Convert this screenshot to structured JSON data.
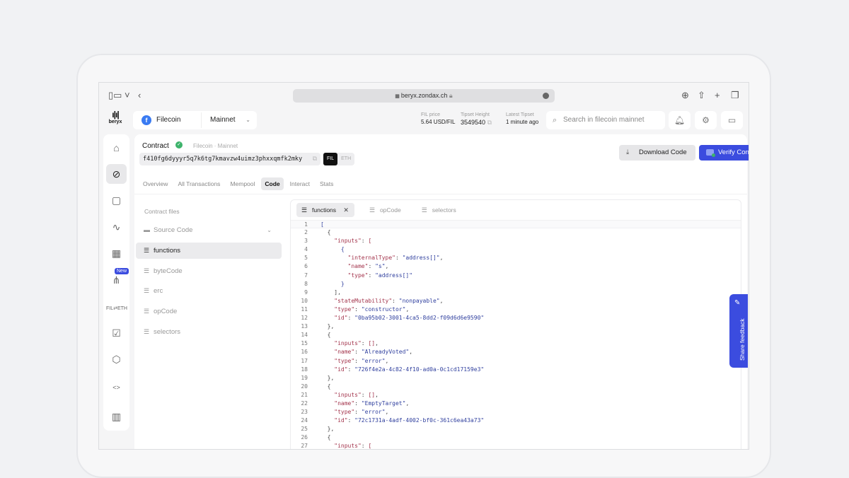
{
  "browser": {
    "url": "beryx.zondax.ch"
  },
  "app": {
    "logo_label": "beryx",
    "network": {
      "chain": "Filecoin",
      "selected": "Mainnet"
    },
    "stats": [
      {
        "label": "FIL price",
        "value": "5.64 USD/FIL"
      },
      {
        "label": "Tipset Height",
        "value": "3549540"
      },
      {
        "label": "Latest Tipset",
        "value": "1 minute ago"
      }
    ],
    "search_placeholder": "Search in filecoin mainnet",
    "nav_badge": "New"
  },
  "contract": {
    "title": "Contract",
    "breadcrumb": "Filecoin · Mainnet",
    "address": "f410fg6dyyyr5q7k6tg7kmavzw4uimz3phxxqmfk2mky",
    "formats": [
      "FIL",
      "ETH"
    ],
    "selected_format": "FIL",
    "download_label": "Download Code",
    "verify_label": "Verify Contract"
  },
  "tabs": [
    "Overview",
    "All Transactions",
    "Mempool",
    "Code",
    "Interact",
    "Stats"
  ],
  "active_tab": "Code",
  "files": {
    "header": "Contract files",
    "folder": "Source Code",
    "items": [
      "functions",
      "byteCode",
      "erc",
      "opCode",
      "selectors"
    ],
    "active": "functions"
  },
  "editor": {
    "tabs": [
      "functions",
      "opCode",
      "selectors"
    ],
    "active_tab": "functions",
    "lines": [
      {
        "n": "1",
        "html": "<span class='s'>[</span>"
      },
      {
        "n": "2",
        "html": "  <span class='p'>{</span>"
      },
      {
        "n": "3",
        "html": "    <span class='k'>\"inputs\"</span>: <span class='k'>[</span>"
      },
      {
        "n": "4",
        "html": "      <span class='s'>{</span>"
      },
      {
        "n": "5",
        "html": "        <span class='k'>\"internalType\"</span>: <span class='s'>\"address[]\"</span>,"
      },
      {
        "n": "6",
        "html": "        <span class='k'>\"name\"</span>: <span class='s'>\"s\"</span>,"
      },
      {
        "n": "7",
        "html": "        <span class='k'>\"type\"</span>: <span class='s'>\"address[]\"</span>"
      },
      {
        "n": "8",
        "html": "      <span class='s'>}</span>"
      },
      {
        "n": "9",
        "html": "    <span class='p'>],</span>"
      },
      {
        "n": "10",
        "html": "    <span class='k'>\"stateMutability\"</span>: <span class='s'>\"nonpayable\"</span>,"
      },
      {
        "n": "11",
        "html": "    <span class='k'>\"type\"</span>: <span class='s'>\"constructor\"</span>,"
      },
      {
        "n": "12",
        "html": "    <span class='k'>\"id\"</span>: <span class='s'>\"0ba95b02-3001-4ca5-8dd2-f09d6d6e9590\"</span>"
      },
      {
        "n": "13",
        "html": "  <span class='p'>},</span>"
      },
      {
        "n": "14",
        "html": "  <span class='p'>{</span>"
      },
      {
        "n": "15",
        "html": "    <span class='k'>\"inputs\"</span>: <span class='k'>[]</span>,"
      },
      {
        "n": "16",
        "html": "    <span class='k'>\"name\"</span>: <span class='s'>\"AlreadyVoted\"</span>,"
      },
      {
        "n": "17",
        "html": "    <span class='k'>\"type\"</span>: <span class='s'>\"error\"</span>,"
      },
      {
        "n": "18",
        "html": "    <span class='k'>\"id\"</span>: <span class='s'>\"726f4e2a-4c82-4f10-ad0a-0c1cd17159e3\"</span>"
      },
      {
        "n": "19",
        "html": "  <span class='p'>},</span>"
      },
      {
        "n": "20",
        "html": "  <span class='p'>{</span>"
      },
      {
        "n": "21",
        "html": "    <span class='k'>\"inputs\"</span>: <span class='k'>[]</span>,"
      },
      {
        "n": "22",
        "html": "    <span class='k'>\"name\"</span>: <span class='s'>\"EmptyTarget\"</span>,"
      },
      {
        "n": "23",
        "html": "    <span class='k'>\"type\"</span>: <span class='s'>\"error\"</span>,"
      },
      {
        "n": "24",
        "html": "    <span class='k'>\"id\"</span>: <span class='s'>\"72c1731a-4adf-4002-bf0c-361c6ea43a73\"</span>"
      },
      {
        "n": "25",
        "html": "  <span class='p'>},</span>"
      },
      {
        "n": "26",
        "html": "  <span class='p'>{</span>"
      },
      {
        "n": "27",
        "html": "    <span class='k'>\"inputs\"</span>: <span class='k'>[</span>"
      }
    ]
  },
  "feedback_label": "Share feedback",
  "colors": {
    "accent": "#3b4cdf",
    "success": "#3db36b",
    "json_key": "#a3344c",
    "json_string": "#2f3f9e"
  }
}
